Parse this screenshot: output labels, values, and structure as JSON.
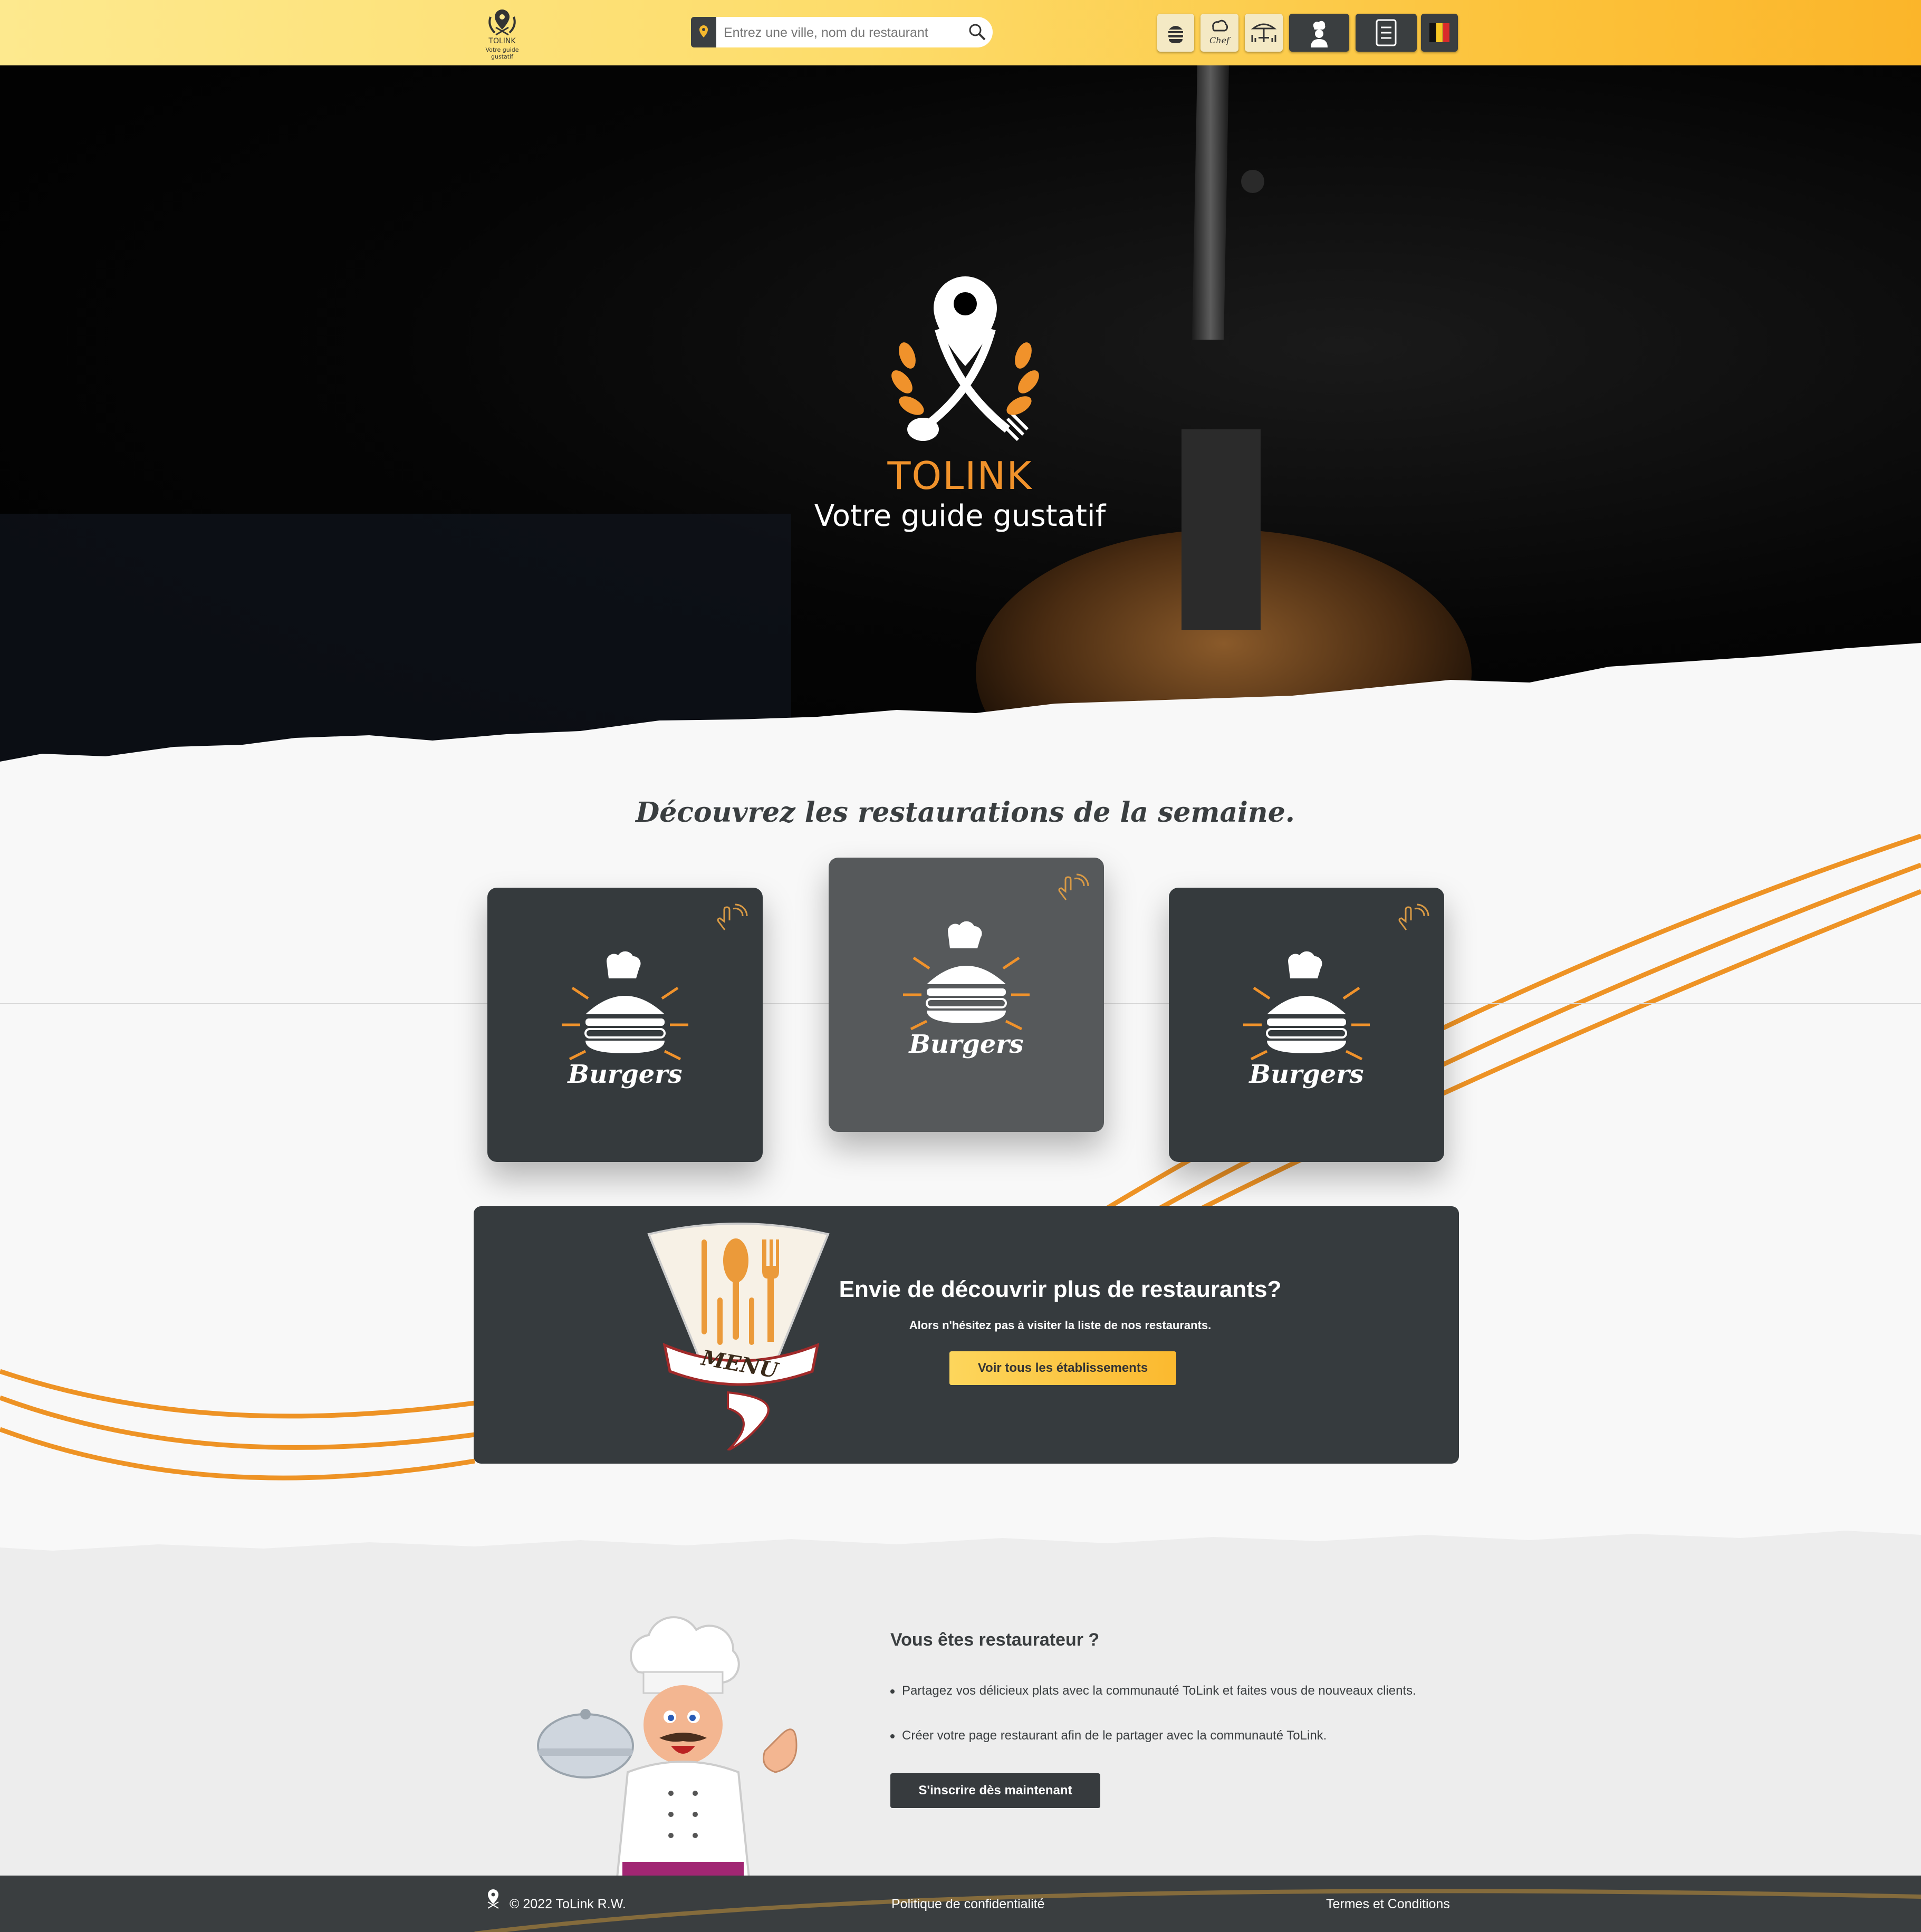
{
  "header": {
    "logo_brand": "TOLINK",
    "logo_tagline": "Votre guide gustatif",
    "search_placeholder": "Entrez une ville, nom du restaurant",
    "nav_icons": [
      "burger-icon",
      "chef-icon",
      "terrace-icon",
      "cook-icon",
      "menu-card-icon",
      "belgium-flag-icon"
    ]
  },
  "hero": {
    "title": "TOLINK",
    "subtitle": "Votre guide gustatif"
  },
  "weekly": {
    "title": "Découvrez les restaurations de la semaine.",
    "cards": [
      {
        "label": "Burgers"
      },
      {
        "label": "Burgers"
      },
      {
        "label": "Burgers"
      }
    ]
  },
  "banner": {
    "menu_word": "MENU",
    "title": "Envie de découvrir plus de restaurants?",
    "subtitle": "Alors n'hésitez pas à visiter la liste de nos restaurants.",
    "button": "Voir tous les établissements"
  },
  "restaurateur": {
    "title": "Vous êtes restaurateur ?",
    "bullets": [
      "Partagez vos délicieux plats avec la communauté ToLink et faites vous de nouveaux clients.",
      "Créer votre page restaurant afin de le partager avec la communauté ToLink."
    ],
    "button": "S'inscrire dès maintenant"
  },
  "footer": {
    "copyright": "© 2022 ToLink R.W.",
    "privacy": "Politique de confidentialité",
    "terms": "Termes et Conditions"
  },
  "colors": {
    "accent": "#f0922b",
    "header_gradient_start": "#fde98e",
    "header_gradient_end": "#fbb52a",
    "dark": "#363b3e"
  }
}
